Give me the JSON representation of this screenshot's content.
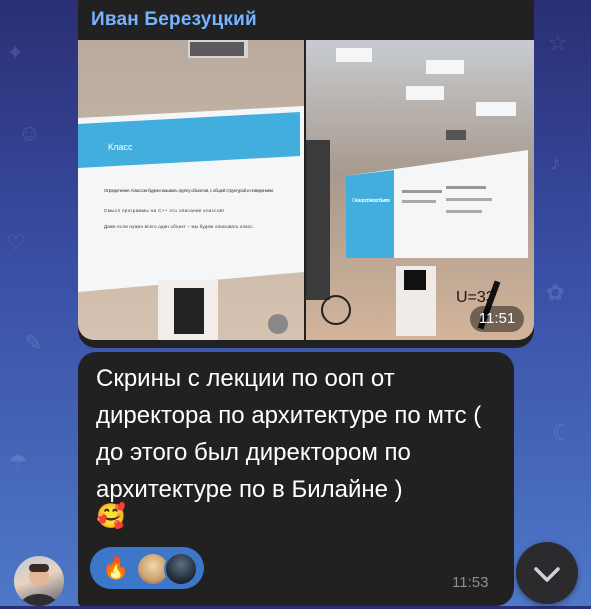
{
  "message": {
    "sender": "Иван Березуцкий",
    "photos_time": "11:51",
    "text": "Скрины с лекции по ооп от директора по архитектуре по мтс ( до этого был директором по архитектуре по в Билайне )",
    "emoji": "🥰",
    "time": "11:53"
  },
  "reaction": {
    "emoji": "🔥"
  },
  "slides": {
    "left": {
      "title": "Класс",
      "items": [
        "Определение. Классом будем называть группу объектов, с общей структурой и поведением.",
        "Смысл программы на C++ это описание классов!",
        "Даже если нужен всего один объект – мы будем описывать класс."
      ]
    },
    "right": {
      "title": "Очень простой класс объектов"
    }
  },
  "icons": {
    "scroll_down": "chevron-down-icon"
  },
  "colors": {
    "bubble": "#212121",
    "sender": "#76b4ff",
    "reaction_bg": "#3d77c9"
  }
}
